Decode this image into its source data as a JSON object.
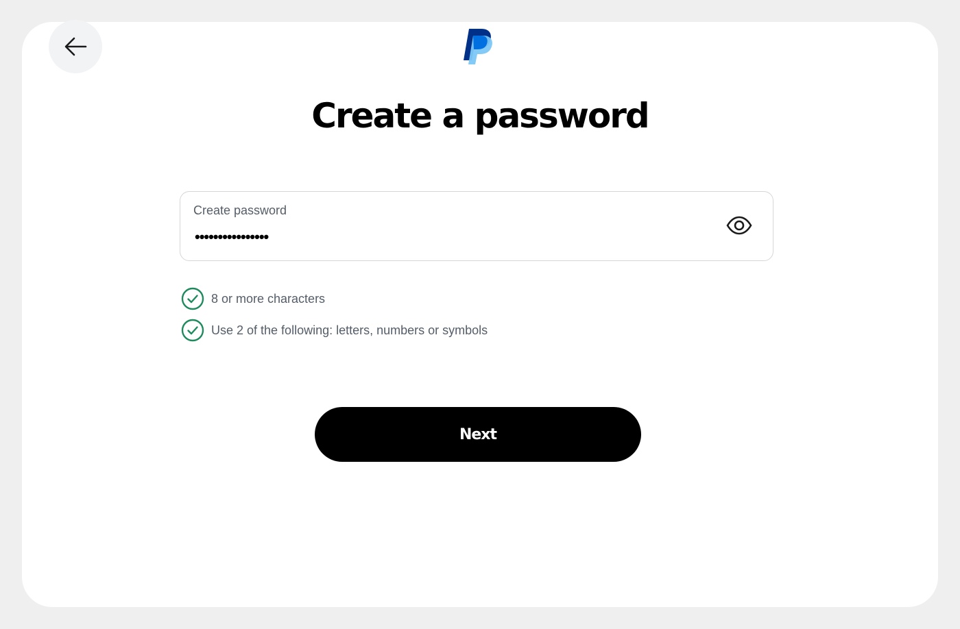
{
  "header": {
    "back_icon": "arrow-left-icon",
    "logo_icon": "paypal-logo-icon",
    "logo_colors": [
      "#003087",
      "#0070e0",
      "#7cc7f7"
    ]
  },
  "main": {
    "title": "Create a password",
    "password_field": {
      "label": "Create password",
      "value": "••••••••••••••••",
      "toggle_icon": "eye-icon"
    },
    "requirements": [
      {
        "text": "8 or more characters",
        "met": true,
        "icon": "check-circle-icon"
      },
      {
        "text": "Use 2 of the following: letters, numbers or symbols",
        "met": true,
        "icon": "check-circle-icon"
      }
    ],
    "next_label": "Next"
  },
  "colors": {
    "check_green": "#1f8a5e",
    "button_bg": "#000000",
    "text_gray": "#545d68"
  }
}
